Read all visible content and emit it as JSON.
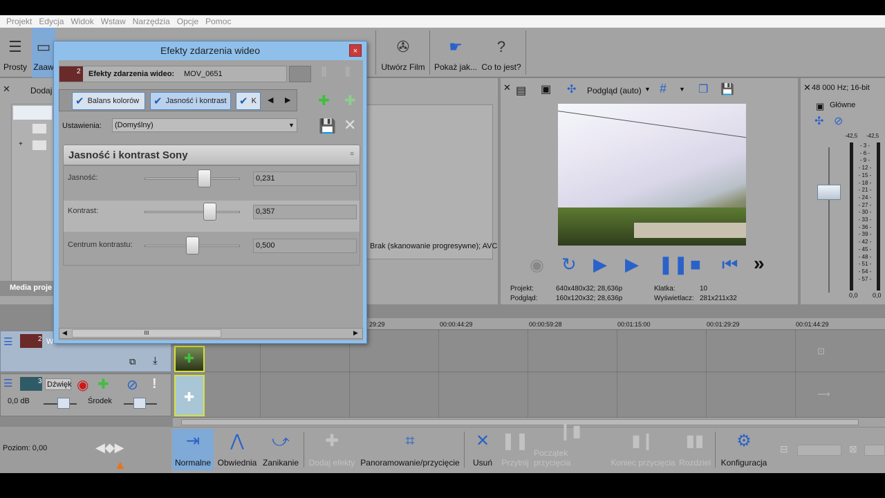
{
  "menu": [
    "Projekt",
    "Edycja",
    "Widok",
    "Wstaw",
    "Narzędzia",
    "Opcje",
    "Pomoc"
  ],
  "toolbar": {
    "prosty": "Prosty",
    "zaaw": "Zaaw",
    "utworz_film": "Utwórz Film",
    "pokaz_jak": "Pokaż jak...",
    "co_to_jest": "Co to jest?"
  },
  "left_panel": {
    "add_label": "Dodaj",
    "media_tab": "Media proje"
  },
  "dialog": {
    "title": "Efekty zdarzenia wideo",
    "close": "×",
    "track_badge": "2",
    "chain_label": "Efekty zdarzenia wideo:",
    "chain_file": "MOV_0651",
    "chips": [
      "Balans kolorów",
      "Jasność i kontrast",
      "K"
    ],
    "presets_label": "Ustawienia:",
    "presets_value": "(Domyślny)",
    "plugin_title": "Jasność i kontrast Sony",
    "params": [
      {
        "label": "Jasność:",
        "value": "0,231",
        "level": 0.62
      },
      {
        "label": "Kontrast:",
        "value": "0,357",
        "level": 0.68
      },
      {
        "label": "Centrum kontrastu:",
        "value": "0,500",
        "level": 0.5
      }
    ],
    "scroll_glyph": "III"
  },
  "middle_info": "Brak (skanowanie progresywne); AVC",
  "preview": {
    "mode": "Podgląd (auto)",
    "projekt_label": "Projekt:",
    "projekt_value": "640x480x32; 28,636p",
    "podglad_label": "Podgląd:",
    "podglad_value": "160x120x32; 28,636p",
    "klatka_label": "Klatka:",
    "klatka_value": "10",
    "wyswietlacz_label": "Wyświetlacz:",
    "wyswietlacz_value": "281x211x32"
  },
  "mixer": {
    "format": "48 000 Hz; 16-bit",
    "bus": "Główne",
    "peak_l": "-42,5",
    "peak_r": "-42,5",
    "scale": [
      "3",
      "6",
      "9",
      "12",
      "15",
      "18",
      "21",
      "24",
      "27",
      "30",
      "33",
      "36",
      "39",
      "42",
      "45",
      "48",
      "51",
      "54",
      "57"
    ],
    "bottom_l": "0,0",
    "bottom_r": "0,0"
  },
  "timeline": {
    "ticks": [
      "29:29",
      "00:00:44:29",
      "00:00:59:28",
      "00:01:15:00",
      "00:01:29:29",
      "00:01:44:29"
    ],
    "video_track_num": "2",
    "video_track_short": "W",
    "audio_track_num": "3",
    "audio_track_name": "Dźwięk",
    "audio_vol": "0,0 dB",
    "audio_pan": "Środek",
    "level_label": "Poziom: 0,00"
  },
  "bottom_toolbar": {
    "normalne": "Normalne",
    "obwiednia": "Obwiednia",
    "zanikanie": "Zanikanie",
    "dodaj_efekty": "Dodaj efekty",
    "panoramowanie": "Panoramowanie/przycięcie",
    "usun": "Usuń",
    "przytnij": "Przytnij",
    "poczatek": "Początek przycięcia",
    "koniec": "Koniec przycięcia",
    "rozdziel": "Rozdziel",
    "konfiguracja": "Konfiguracja"
  },
  "colors": {
    "accent": "#5c8fc0",
    "dialog_frame": "#8fc0ec",
    "record": "#d01818",
    "add_green": "#3fbf3f"
  }
}
